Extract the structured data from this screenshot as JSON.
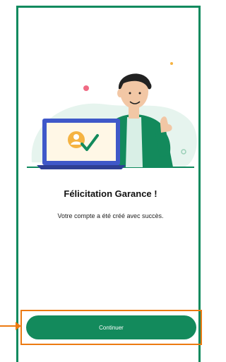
{
  "congrats": {
    "title": "Félicitation Garance !",
    "message": "Votre compte a été créé avec succès."
  },
  "actions": {
    "continue_label": "Continuer"
  },
  "colors": {
    "brand_green": "#138a5c",
    "frame_green": "#0f8a5e",
    "highlight_orange": "#ec7a12"
  },
  "icons": [
    "success-illustration",
    "checkmark-icon",
    "user-avatar-icon",
    "arrow-annotation"
  ]
}
